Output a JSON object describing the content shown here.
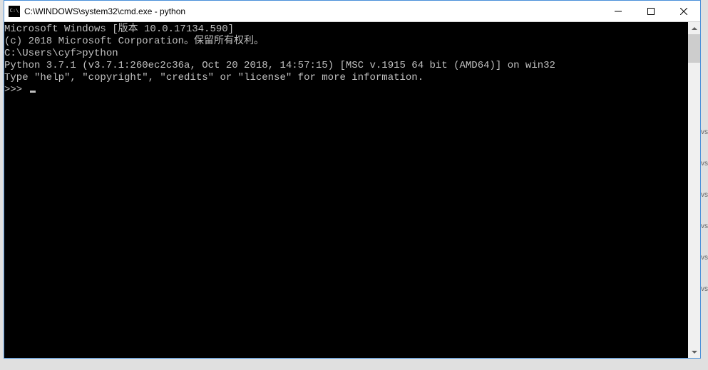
{
  "window": {
    "title": "C:\\WINDOWS\\system32\\cmd.exe - python"
  },
  "terminal": {
    "lines": [
      "Microsoft Windows [版本 10.0.17134.590]",
      "(c) 2018 Microsoft Corporation。保留所有权利。",
      "",
      "C:\\Users\\cyf>python",
      "Python 3.7.1 (v3.7.1:260ec2c36a, Oct 20 2018, 14:57:15) [MSC v.1915 64 bit (AMD64)] on win32",
      "Type \"help\", \"copyright\", \"credits\" or \"license\" for more information.",
      ">>> "
    ]
  }
}
